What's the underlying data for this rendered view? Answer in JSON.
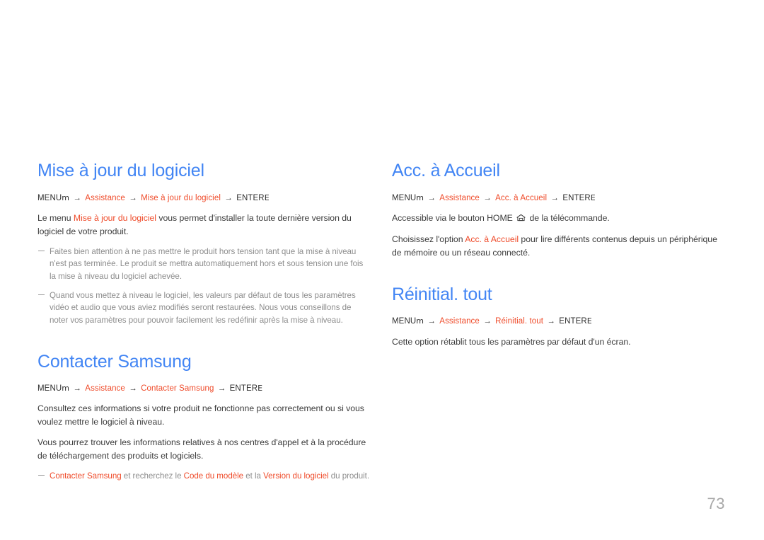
{
  "page": {
    "number": "73",
    "accent_blue": "#4285f4",
    "accent_orange": "#ef4b2a",
    "body_gray": "#3c3c3c",
    "note_gray": "#8d8d8d"
  },
  "menu_tokens": {
    "menu_label": "MENU",
    "menu_glyph": "m",
    "arrow": "→",
    "assistance": "Assistance",
    "enter_label": "ENTER",
    "enter_glyph": "E"
  },
  "left_column": {
    "sections": [
      {
        "id": "mise-a-jour-du-logiciel",
        "title": "Mise à jour du logiciel",
        "menu_path_item": "Mise à jour du logiciel",
        "paragraphs": [
          {
            "parts": [
              {
                "text": "Le menu ",
                "style": "plain"
              },
              {
                "text": "Mise à jour du logiciel",
                "style": "accent"
              },
              {
                "text": " vous permet d'installer la toute dernière version du logiciel de votre produit.",
                "style": "plain"
              }
            ]
          }
        ],
        "notes": [
          {
            "parts": [
              {
                "text": "Faites bien attention à ne pas mettre le produit hors tension tant que la mise à niveau n'est pas terminée. Le produit se mettra automatiquement hors et sous tension une fois la mise à niveau du logiciel achevée.",
                "style": "plain"
              }
            ]
          },
          {
            "parts": [
              {
                "text": "Quand vous mettez à niveau le logiciel, les valeurs par défaut de tous les paramètres vidéo et audio que vous aviez modifiés seront restaurées. Nous vous conseillons de noter vos paramètres pour pouvoir facilement les redéfinir après la mise à niveau.",
                "style": "plain"
              }
            ]
          }
        ]
      },
      {
        "id": "contacter-samsung",
        "title": "Contacter Samsung",
        "menu_path_item": "Contacter Samsung",
        "paragraphs": [
          {
            "parts": [
              {
                "text": "Consultez ces informations si votre produit ne fonctionne pas correctement ou si vous voulez mettre le logiciel à niveau.",
                "style": "plain"
              }
            ]
          },
          {
            "parts": [
              {
                "text": "Vous pourrez trouver les informations relatives à nos centres d'appel et à la procédure de téléchargement des produits et logiciels.",
                "style": "plain"
              }
            ]
          }
        ],
        "notes": [
          {
            "parts": [
              {
                "text": "Contacter Samsung",
                "style": "accent"
              },
              {
                "text": " et recherchez le ",
                "style": "plain"
              },
              {
                "text": "Code du modèle",
                "style": "accent"
              },
              {
                "text": " et la ",
                "style": "plain"
              },
              {
                "text": "Version du logiciel",
                "style": "accent"
              },
              {
                "text": " du produit.",
                "style": "plain"
              }
            ]
          }
        ]
      }
    ]
  },
  "right_column": {
    "sections": [
      {
        "id": "acc-a-accueil",
        "title": "Acc. à Accueil",
        "menu_path_item": "Acc. à Accueil",
        "paragraphs": [
          {
            "parts": [
              {
                "text": "Accessible via le bouton HOME ",
                "style": "plain"
              },
              {
                "text": "",
                "style": "home-icon"
              },
              {
                "text": " de la télécommande.",
                "style": "plain"
              }
            ]
          },
          {
            "parts": [
              {
                "text": "Choisissez l'option ",
                "style": "plain"
              },
              {
                "text": "Acc. à Accueil",
                "style": "accent"
              },
              {
                "text": " pour lire différents contenus depuis un périphérique de mémoire ou un réseau connecté.",
                "style": "plain"
              }
            ]
          }
        ],
        "notes": []
      },
      {
        "id": "reinitial-tout",
        "title": "Réinitial. tout",
        "menu_path_item": "Réinitial. tout",
        "paragraphs": [
          {
            "parts": [
              {
                "text": "Cette option rétablit tous les paramètres par défaut d'un écran.",
                "style": "plain"
              }
            ]
          }
        ],
        "notes": []
      }
    ]
  },
  "icons": {
    "home": "home-icon"
  }
}
